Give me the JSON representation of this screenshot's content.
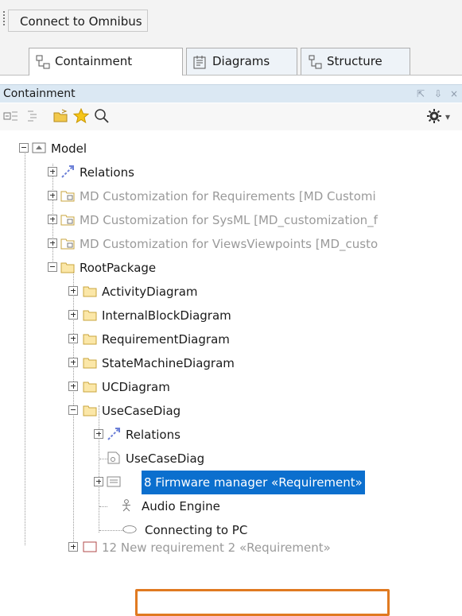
{
  "toolbar": {
    "connect_label": "Connect to Omnibus"
  },
  "tabs": [
    {
      "label": "Containment",
      "icon": "containment-icon",
      "active": true
    },
    {
      "label": "Diagrams",
      "icon": "diagrams-icon",
      "active": false
    },
    {
      "label": "Structure",
      "icon": "structure-icon",
      "active": false
    }
  ],
  "panel": {
    "title": "Containment",
    "controls": [
      "pin-icon",
      "dock-icon",
      "close-icon"
    ],
    "tools": [
      "expand-all-icon",
      "collapse-all-icon",
      "open-folder-icon",
      "favorite-star-icon",
      "search-icon",
      "settings-gear-icon"
    ]
  },
  "tree": {
    "model": "Model",
    "relations": "Relations",
    "md_req": "MD Customization for Requirements [MD Customi",
    "md_sysml": "MD Customization for SysML [MD_customization_f",
    "md_views": "MD Customization for ViewsViewpoints [MD_custo",
    "root": "RootPackage",
    "activity": "ActivityDiagram",
    "ibd": "InternalBlockDiagram",
    "req_diag": "RequirementDiagram",
    "state": "StateMachineDiagram",
    "uc": "UCDiagram",
    "usecase": "UseCaseDiag",
    "uc_relations": "Relations",
    "uc_diag": "UseCaseDiag",
    "firmware": "8 Firmware manager «Requirement»",
    "audio": "Audio Engine",
    "connecting": "Connecting to PC",
    "partial": "12 New requirement 2 «Requirement»"
  },
  "colors": {
    "selection": "#0b6fce",
    "highlight_border": "#e07a21",
    "folder": "#e8c66a"
  }
}
